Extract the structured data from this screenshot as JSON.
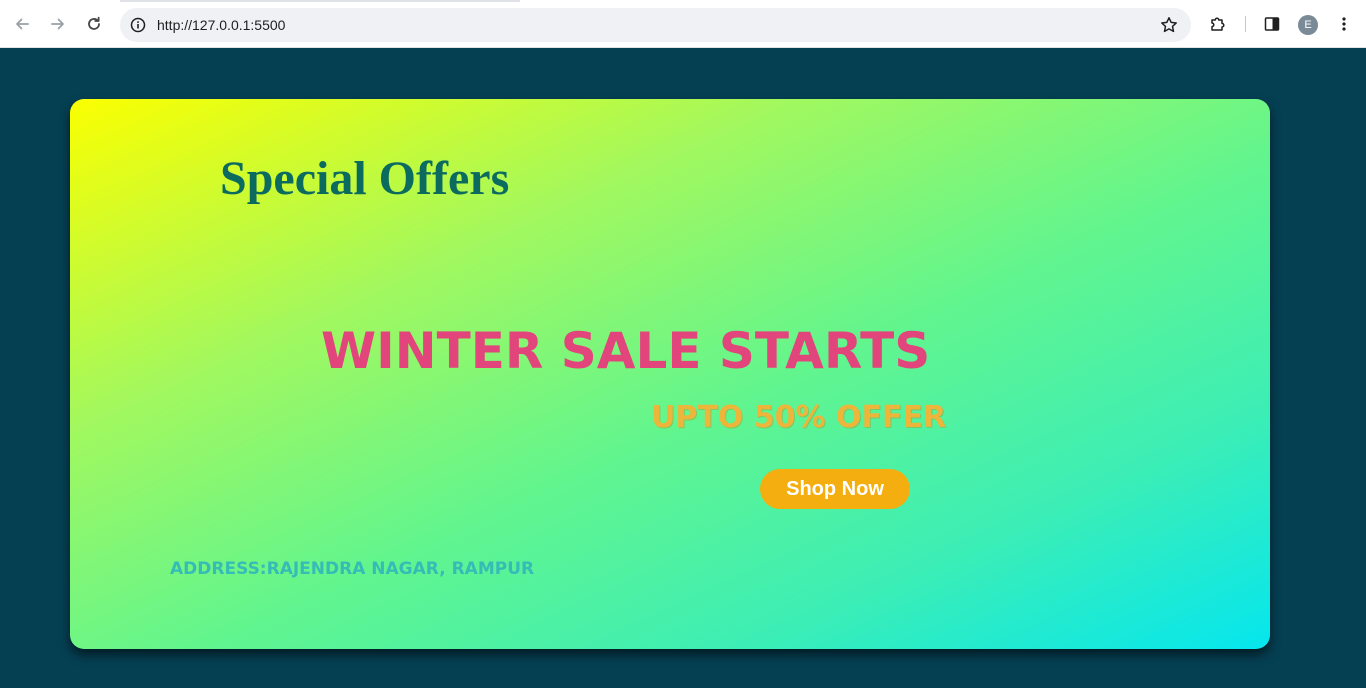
{
  "browser": {
    "url": "http://127.0.0.1:5500",
    "profile_initial": "E",
    "icons": {
      "back": "arrow-left-icon",
      "forward": "arrow-right-icon",
      "reload": "reload-icon",
      "site_info": "info-icon",
      "bookmark": "star-icon",
      "extensions": "puzzle-icon",
      "side_panel": "side-panel-icon",
      "menu": "kebab-menu-icon"
    }
  },
  "page": {
    "background_color": "#053f52",
    "card": {
      "title": "Special Offers",
      "headline": "WINTER SALE STARTS",
      "offer": "UPTO 50% OFFER",
      "button_label": "Shop Now",
      "address": "ADDRESS:RAJENDRA NAGAR, RAMPUR",
      "colors": {
        "title": "#0c6b5f",
        "headline": "#e2447c",
        "offer": "#edb63a",
        "button": "#f4ae0f",
        "address": "#36bcb6",
        "gradient_start": "#fbff00",
        "gradient_end": "#05e6ee"
      }
    }
  }
}
